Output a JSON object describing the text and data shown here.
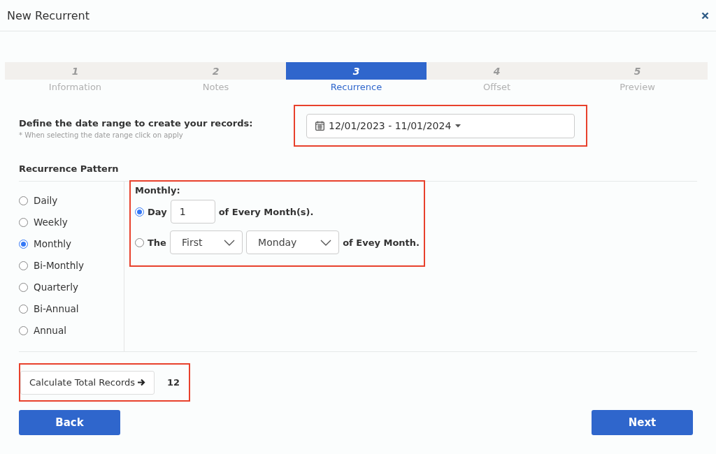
{
  "window": {
    "title": "New Recurrent"
  },
  "steps": [
    {
      "number": "1",
      "label": "Information",
      "selected": false
    },
    {
      "number": "2",
      "label": "Notes",
      "selected": false
    },
    {
      "number": "3",
      "label": "Recurrence",
      "selected": true
    },
    {
      "number": "4",
      "label": "Offset",
      "selected": false
    },
    {
      "number": "5",
      "label": "Preview",
      "selected": false
    }
  ],
  "date_range": {
    "label": "Define the date range to create your records:",
    "hint": "* When selecting the date range click on apply",
    "value": "12/01/2023 - 11/01/2024",
    "highlighted": true
  },
  "pattern": {
    "title": "Recurrence Pattern",
    "options": [
      {
        "label": "Daily",
        "selected": false
      },
      {
        "label": "Weekly",
        "selected": false
      },
      {
        "label": "Monthly",
        "selected": true
      },
      {
        "label": "Bi-Monthly",
        "selected": false
      },
      {
        "label": "Quarterly",
        "selected": false
      },
      {
        "label": "Bi-Annual",
        "selected": false
      },
      {
        "label": "Annual",
        "selected": false
      }
    ]
  },
  "monthly": {
    "title": "Monthly:",
    "highlighted": true,
    "choices": [
      {
        "kind": "day",
        "selected": true,
        "label": "Day",
        "value": "1",
        "suffix": "of Every Month(s)."
      },
      {
        "kind": "weekday",
        "selected": false,
        "label": "The",
        "ordinal": "First",
        "weekday": "Monday",
        "suffix": "of Evey Month."
      }
    ]
  },
  "calculate": {
    "button": "Calculate Total Records",
    "result": "12",
    "highlighted": true
  },
  "buttons": {
    "back": "Back",
    "next": "Next"
  }
}
